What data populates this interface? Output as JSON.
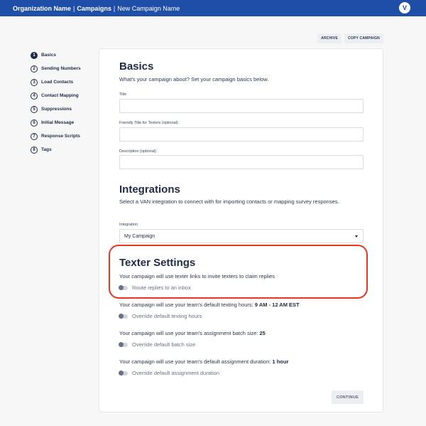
{
  "header": {
    "org": "Organization Name",
    "section": "Campaigns",
    "separator": "|",
    "campaign_name": "New Campaign Name",
    "avatar_letter": "V"
  },
  "actions": {
    "archive": "ARCHIVE",
    "copy": "COPY CAMPAIGN"
  },
  "steps": [
    {
      "num": "1",
      "label": "Basics"
    },
    {
      "num": "2",
      "label": "Sending Numbers"
    },
    {
      "num": "3",
      "label": "Load Contacts"
    },
    {
      "num": "4",
      "label": "Contact Mapping"
    },
    {
      "num": "5",
      "label": "Suppressions"
    },
    {
      "num": "6",
      "label": "Initial Message"
    },
    {
      "num": "7",
      "label": "Response Scripts"
    },
    {
      "num": "8",
      "label": "Tags"
    }
  ],
  "basics": {
    "heading": "Basics",
    "description": "What's your campaign about? Set your campaign basics below.",
    "title_label": "Title",
    "title_value": "",
    "friendly_label": "Friendly Title for Texters (optional)",
    "friendly_value": "",
    "description_label": "Description (optional)",
    "description_value": ""
  },
  "integrations": {
    "heading": "Integrations",
    "description": "Select a VAN integration to connect with for importing contacts or mapping survey responses.",
    "integration_label": "Integration",
    "integration_value": "My Campaign"
  },
  "texter": {
    "heading": "Texter Settings",
    "description": "Your campaign will use texter links to invite texters to claim replies",
    "route_toggle": "Route replies to an inbox",
    "hours_text": "Your campaign will use your team's default texting hours: ",
    "hours_value": "9 AM - 12 AM EST",
    "hours_toggle": "Override default texting hours",
    "batch_text": "Your campaign will use your team's assignment batch size: ",
    "batch_value": "25",
    "batch_toggle": "Override default batch size",
    "duration_text": "Your campaign will use your team's default assignment duration: ",
    "duration_value": "1 hour",
    "duration_toggle": "Override default assignment duration"
  },
  "continue_label": "CONTINUE",
  "colors": {
    "header_bg": "#1f4ea8",
    "highlight": "#e8361f",
    "text_dark": "#1f2a44"
  }
}
